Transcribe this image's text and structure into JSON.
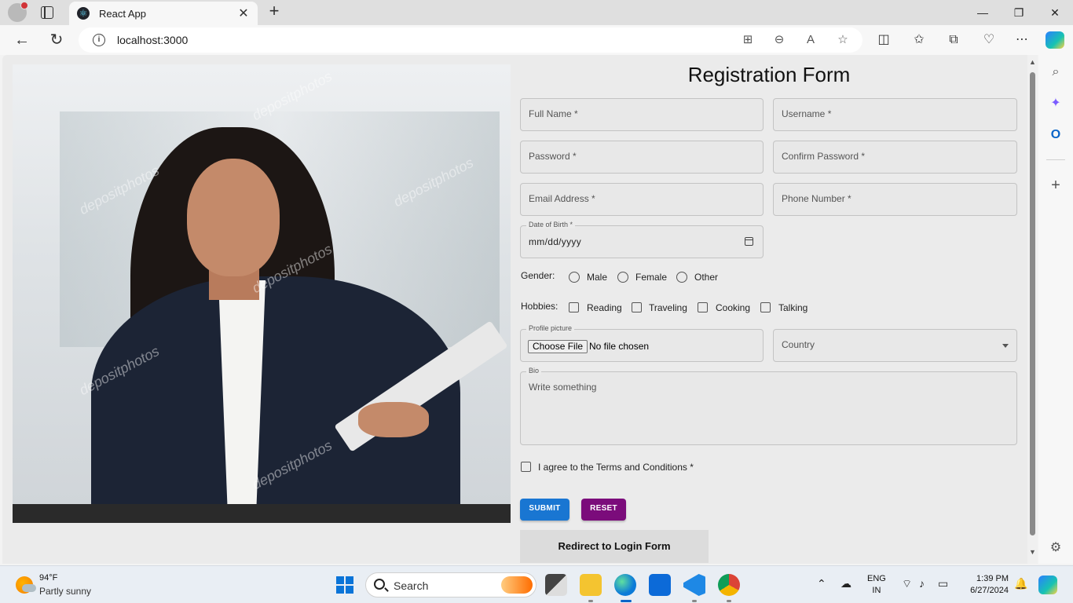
{
  "browser": {
    "tab_title": "React App",
    "url": "localhost:3000"
  },
  "page": {
    "title": "Registration Form",
    "fields": {
      "full_name": "Full Name *",
      "username": "Username *",
      "password": "Password *",
      "confirm_password": "Confirm Password *",
      "email": "Email Address *",
      "phone": "Phone Number *",
      "dob_label": "Date of Birth *",
      "dob_value": "mm/dd/yyyy",
      "profile_label": "Profile picture",
      "choose_file": "Choose File",
      "no_file": "No file chosen",
      "country": "Country",
      "bio_label": "Bio",
      "bio_placeholder": "Write something"
    },
    "gender": {
      "label": "Gender:",
      "options": [
        "Male",
        "Female",
        "Other"
      ]
    },
    "hobbies": {
      "label": "Hobbies:",
      "options": [
        "Reading",
        "Traveling",
        "Cooking",
        "Talking"
      ]
    },
    "terms": "I agree to the Terms and Conditions *",
    "submit": "SUBMIT",
    "reset": "RESET",
    "redirect": "Redirect to Login Form",
    "photo_watermark": "depositphotos"
  },
  "taskbar": {
    "temperature": "94°F",
    "weather": "Partly sunny",
    "search": "Search",
    "lang_line1": "ENG",
    "lang_line2": "IN",
    "time": "1:39 PM",
    "date": "6/27/2024"
  },
  "colors": {
    "submit": "#1976d2",
    "reset": "#7b0c7b"
  }
}
